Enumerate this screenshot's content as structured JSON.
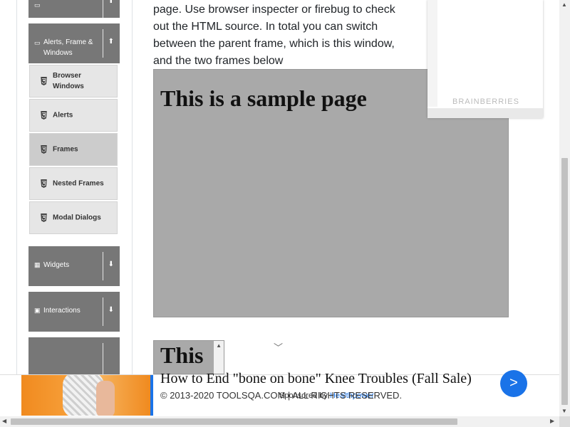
{
  "sidebar": {
    "groups": [
      {
        "label": "",
        "arrow": "⬆"
      },
      {
        "label": "Alerts, Frame & Windows",
        "arrow": "⬆"
      },
      {
        "label": "Widgets",
        "arrow": "⬇"
      },
      {
        "label": "Interactions",
        "arrow": "⬇"
      },
      {
        "label": "",
        "arrow": "⬇"
      }
    ],
    "items": [
      {
        "label": "Browser Windows"
      },
      {
        "label": "Alerts"
      },
      {
        "label": "Frames"
      },
      {
        "label": "Nested Frames"
      },
      {
        "label": "Modal Dialogs"
      }
    ]
  },
  "main": {
    "intro_text": "page. Use browser inspecter or firebug to check out the HTML source. In total you can switch between the parent frame, which is this window, and the two frames below",
    "frame1_heading": "This is a sample page",
    "frame2_heading": "This"
  },
  "ad": {
    "brand": "BRAINBERRIES",
    "headline": "How to End \"bone on bone\" Knee Troubles (Fall Sale)",
    "sponsored_prefix": "Sponsored by",
    "sponsor": "Healthpower",
    "cta": ">"
  },
  "footer": {
    "copyright": "© 2013-2020 TOOLSQA.COM | ALL RIGHTS RESERVED."
  },
  "colors": {
    "accent": "#1a73e8",
    "sidebar_header": "#777777",
    "frame_bg": "#a9a9a9"
  }
}
